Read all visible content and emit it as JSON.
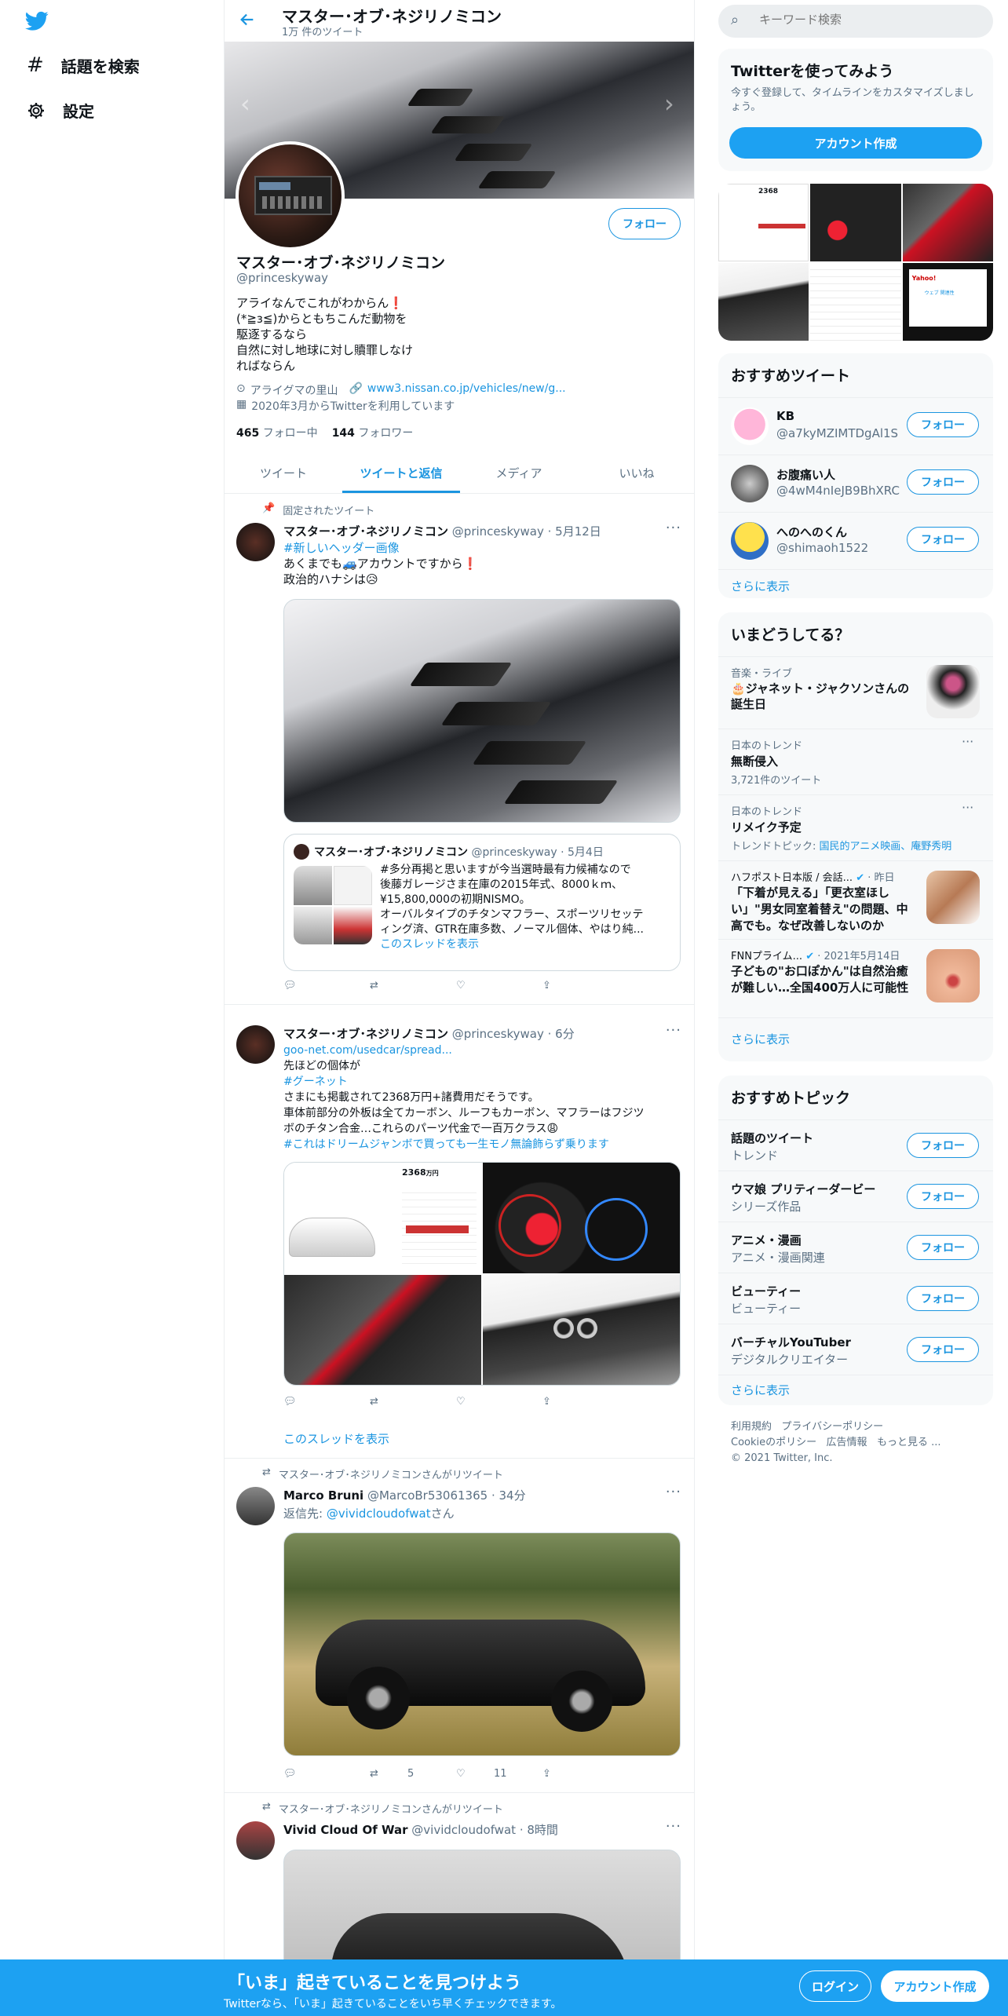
{
  "nav": {
    "explore": "話題を検索",
    "settings": "設定"
  },
  "header": {
    "name": "マスター･オブ･ネジリノミコン",
    "tweet_count": "1万 件のツイート"
  },
  "profile": {
    "name": "マスター･オブ･ネジリノミコン",
    "handle": "@princeskyway",
    "follow_label": "フォロー",
    "bio": [
      "アライなんでこれがわからん❗",
      "(*≧з≦)からともちこんだ動物を",
      "駆逐するなら",
      "自然に対し地球に対し贖罪しなけ",
      "ればならん"
    ],
    "location": "アライグマの里山",
    "url": "www3.nissan.co.jp/vehicles/new/g...",
    "joined": "2020年3月からTwitterを利用しています",
    "following_count": "465",
    "following_label": "フォロー中",
    "followers_count": "144",
    "followers_label": "フォロワー"
  },
  "tabs": [
    "ツイート",
    "ツイートと返信",
    "メディア",
    "いいね"
  ],
  "tweets": [
    {
      "pinned_label": "固定されたツイート",
      "name": "マスター･オブ･ネジリノミコン",
      "handle": "@princeskyway",
      "time": "· 5月12日",
      "lines": [
        "#新しいヘッダー画像",
        "あくまでも🚙アカウントですから❗",
        "政治的ハナシは😥"
      ],
      "quote": {
        "name": "マスター･オブ･ネジリノミコン",
        "handle": "@princeskyway",
        "time": "· 5月4日",
        "lines": [
          "#多分再掲と思いますが今当選時最有力候補なので",
          "後藤ガレージさま在庫の2015年式、8000ｋｍ、",
          "¥15,800,000の初期NISMO。",
          "オーバルタイプのチタンマフラー、スポーツリセッテ",
          "ィング済、GTR在庫多数、ノーマル個体、やはり純..."
        ],
        "thread": "このスレッドを表示"
      }
    },
    {
      "name": "マスター･オブ･ネジリノミコン",
      "handle": "@princeskyway",
      "time": "· 6分",
      "link": "goo-net.com/usedcar/spread...",
      "lines": [
        "先ほどの個体が",
        "#グーネット",
        "さまにも掲載されて2368万円+諸費用だそうです。",
        "車体前部分の外板は全てカーボン、ルーフもカーボン、マフラーはフジツ",
        "ボのチタン合金…これらのパーツ代金で一百万クラス😩",
        "#これはドリームジャンボで買っても一生モノ無論飾らず乗ります"
      ],
      "thread": "このスレッドを表示",
      "img_price": "2368",
      "img_price_unit": "万円"
    },
    {
      "retweet_label": "マスター･オブ･ネジリノミコンさんがリツイート",
      "name": "Marco Bruni",
      "handle": "@MarcoBr53061365",
      "time": "· 34分",
      "reply_prefix": "返信先: ",
      "reply_to": "@vividcloudofwat",
      "reply_suffix": "さん",
      "retweets": "5",
      "likes": "11"
    },
    {
      "retweet_label": "マスター･オブ･ネジリノミコンさんがリツイート",
      "name": "Vivid Cloud Of War",
      "handle": "@vividcloudofwat",
      "time": "· 8時間"
    }
  ],
  "search": {
    "placeholder": "キーワード検索"
  },
  "signup": {
    "title": "Twitterを使ってみよう",
    "text": "今すぐ登録して、タイムラインをカスタマイズしましょう。",
    "button": "アカウント作成"
  },
  "media_grid_text": {
    "cell1_price": "2368",
    "cell5_title": "Yahoo!",
    "cell5_link": "ウェブ 関連性"
  },
  "recommended": {
    "title": "おすすめツイート",
    "users": [
      {
        "name": "KB",
        "handle": "@a7kyMZIMTDgAl1S"
      },
      {
        "name": "お腹痛い人",
        "handle": "@4wM4nIeJB9BhXRC"
      },
      {
        "name": "へのへのくん",
        "handle": "@shimaoh1522"
      }
    ],
    "follow": "フォロー",
    "more": "さらに表示"
  },
  "trends": {
    "title": "いまどうしてる？",
    "items": [
      {
        "meta": "音楽・ライブ",
        "title": "🎂ジャネット・ジャクソンさんの誕生日"
      },
      {
        "meta": "日本のトレンド",
        "title": "無断侵入",
        "sub": "3,721件のツイート"
      },
      {
        "meta": "日本のトレンド",
        "title": "リメイク予定",
        "sub_prefix": "トレンドトピック: ",
        "sub_link": "国民的アニメ映画、庵野秀明"
      },
      {
        "meta_source": "ハフポスト日本版 / 会話...",
        "meta_time": "· 昨日",
        "title": "「下着が見える」「更衣室ほしい」\"男女同室着替え\"の問題、中高でも。なぜ改善しないのか"
      },
      {
        "meta_source": "FNNプライム...",
        "meta_time": "· 2021年5月14日",
        "title": "子どもの\"お口ぽかん\"は自然治癒が難しい…全国400万人に可能性"
      }
    ],
    "more": "さらに表示"
  },
  "topics": {
    "title": "おすすめトピック",
    "items": [
      {
        "name": "話題のツイート",
        "sub": "トレンド"
      },
      {
        "name": "ウマ娘 プリティーダービー",
        "sub": "シリーズ作品"
      },
      {
        "name": "アニメ・漫画",
        "sub": "アニメ・漫画関連"
      },
      {
        "name": "ビューティー",
        "sub": "ビューティー"
      },
      {
        "name": "バーチャルYouTuber",
        "sub": "デジタルクリエイター"
      }
    ],
    "follow": "フォロー",
    "more": "さらに表示"
  },
  "footer": {
    "l1": "利用規約",
    "l2": "プライバシーポリシー",
    "l3": "Cookieのポリシー",
    "l4": "広告情報",
    "l5": "もっと見る ...",
    "copy": "© 2021 Twitter, Inc."
  },
  "bottom": {
    "title": "「いま」起きていることを見つけよう",
    "sub": "Twitterなら、「いま」起きていることをいち早くチェックできます。",
    "login": "ログイン",
    "signup": "アカウント作成"
  }
}
